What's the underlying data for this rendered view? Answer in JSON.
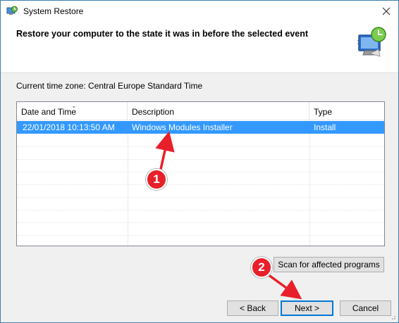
{
  "window": {
    "title": "System Restore",
    "icon": "system-restore-icon"
  },
  "header": {
    "title": "Restore your computer to the state it was in before the selected event",
    "icon": "restore-computer-icon"
  },
  "timezone_text": "Current time zone: Central Europe Standard Time",
  "table": {
    "columns": [
      "Date and Time",
      "Description",
      "Type"
    ],
    "sorted_column": "Date and Time",
    "rows": [
      {
        "date": "22/01/2018 10:13:50 AM",
        "description": "Windows Modules Installer",
        "type": "Install",
        "selected": true
      }
    ]
  },
  "buttons": {
    "scan": "Scan for affected programs",
    "back": "< Back",
    "next": "Next >",
    "cancel": "Cancel"
  },
  "annotations": [
    {
      "label": "1",
      "color": "#e8202a"
    },
    {
      "label": "2",
      "color": "#e8202a"
    }
  ],
  "colors": {
    "selection": "#3399ff",
    "accent": "#0078d7",
    "annotation": "#e8202a"
  }
}
